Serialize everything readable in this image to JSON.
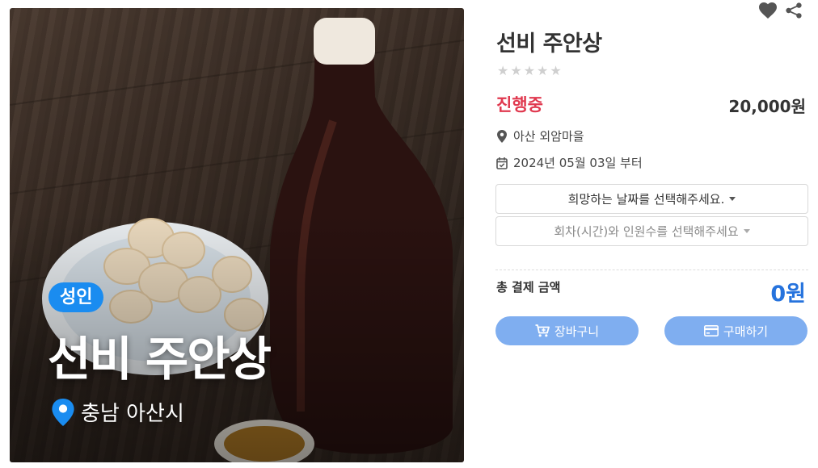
{
  "hero": {
    "badge": "성인",
    "title": "선비 주안상",
    "location": "충남 아산시"
  },
  "product": {
    "title": "선비 주안상",
    "rating_stars": 5,
    "rating_value": 0,
    "status": "진행중",
    "price": "20,000원",
    "location": "아산 외암마을",
    "date": "2024년 05월 03일 부터"
  },
  "selects": {
    "date_placeholder": "희망하는 날짜를 선택해주세요.",
    "time_placeholder": "회차(시간)와 인원수를 선택해주세요"
  },
  "total": {
    "label": "총 결제 금액",
    "value": "0원"
  },
  "buttons": {
    "cart": "장바구니",
    "buy": "구매하기"
  },
  "icons": {
    "favorite": "heart-icon",
    "share": "share-icon",
    "location": "map-marker-icon",
    "date": "calendar-check-icon",
    "cart": "cart-plus-icon",
    "buy": "credit-card-icon"
  },
  "colors": {
    "status": "#e0394f",
    "total": "#2673dd",
    "button": "#7faef0",
    "badge": "#1a8cf0"
  }
}
